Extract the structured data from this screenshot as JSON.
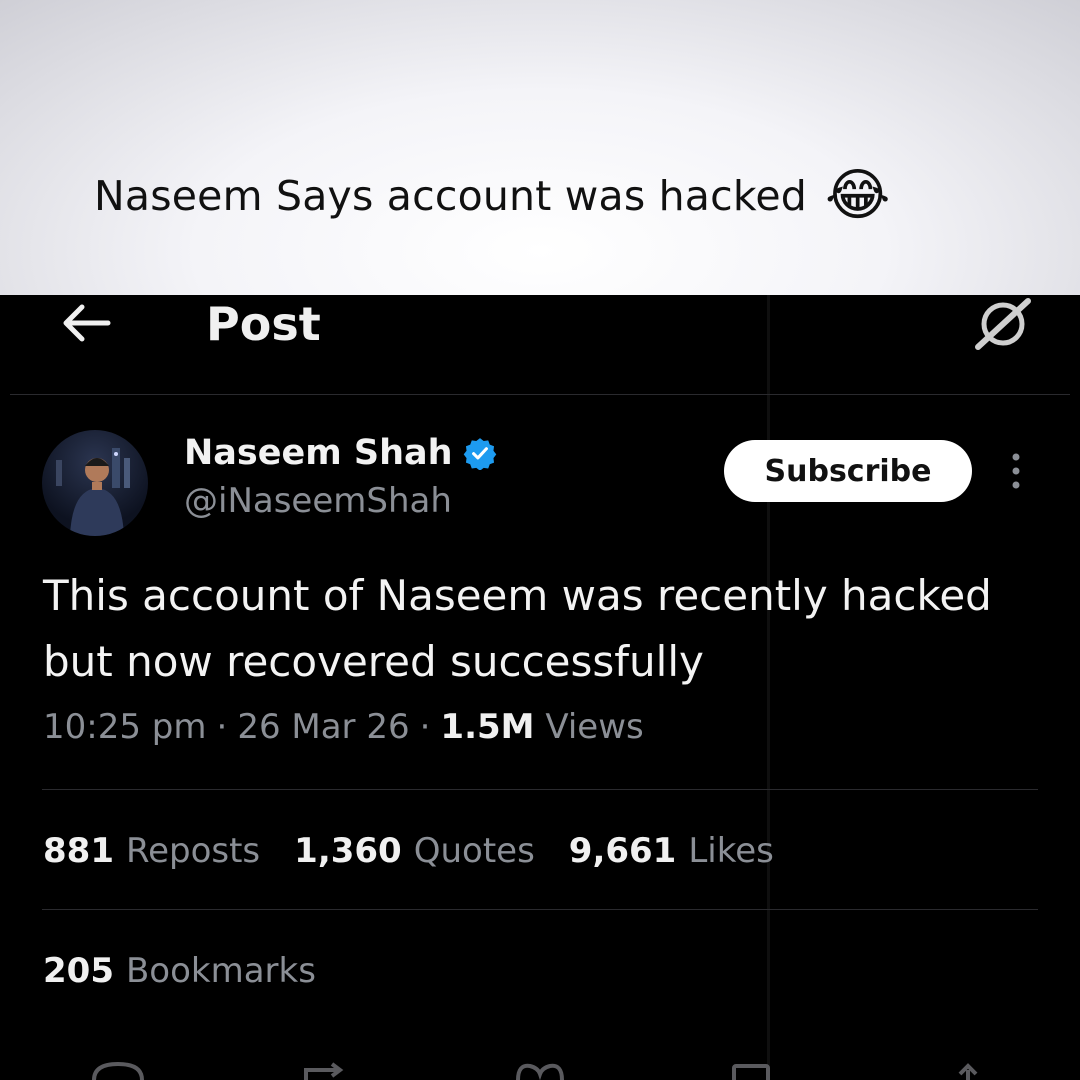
{
  "caption": {
    "text": "Naseem Says account was hacked",
    "emoji": "😂"
  },
  "header": {
    "title": "Post",
    "back_icon": "arrow-left-icon",
    "grok_icon": "grok-icon"
  },
  "post": {
    "author": {
      "name": "Naseem Shah",
      "handle": "@iNaseemShah",
      "verified": true,
      "verified_color": "#1d9bf0"
    },
    "subscribe_label": "Subscribe",
    "text": "This account of Naseem was recently hacked but now recovered successfully",
    "meta": {
      "time": "10:25 pm",
      "date": "26 Mar 26",
      "views_count": "1.5M",
      "views_label": "Views"
    },
    "stats": [
      {
        "count": "881",
        "label": "Reposts"
      },
      {
        "count": "1,360",
        "label": "Quotes"
      },
      {
        "count": "9,661",
        "label": "Likes"
      }
    ],
    "bookmarks": {
      "count": "205",
      "label": "Bookmarks"
    }
  },
  "colors": {
    "background": "#000000",
    "text_primary": "#f0f0f0",
    "text_secondary": "#8b8f96",
    "verified_badge": "#1d9bf0",
    "button_bg": "#ffffff"
  },
  "action_bar_icons": [
    "reply-icon",
    "repost-icon",
    "like-icon",
    "bookmark-icon",
    "share-icon"
  ]
}
